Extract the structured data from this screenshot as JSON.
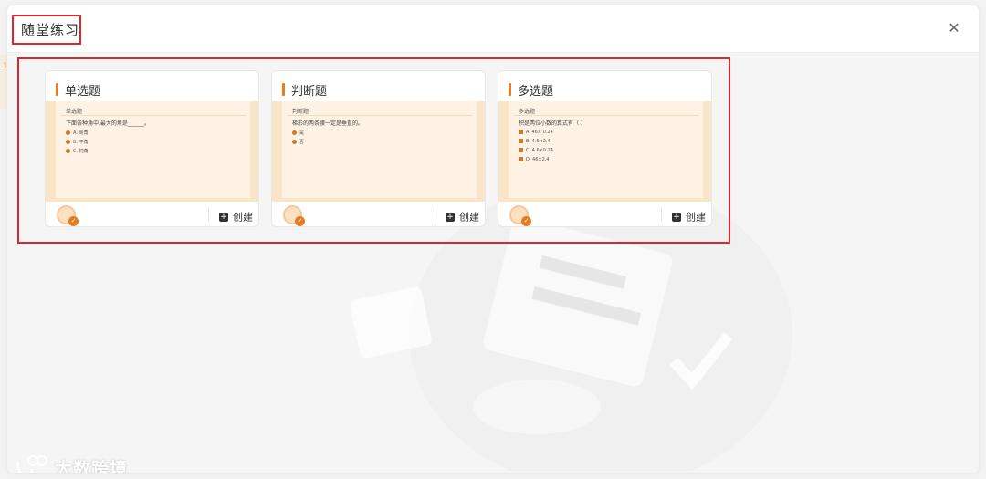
{
  "dialog": {
    "title": "随堂练习",
    "close_icon": "close-icon"
  },
  "background_digit": "1",
  "cards": [
    {
      "title": "单选题",
      "preview": {
        "type": "单选题",
        "question": "下面各种角中,最大的角是______。",
        "option_marker": "dot",
        "options": [
          "A. 周角",
          "B. 平角",
          "C. 钝角"
        ]
      },
      "create_label": "创建"
    },
    {
      "title": "判断题",
      "preview": {
        "type": "判断题",
        "question": "梯形的两条腰一定是垂直的。",
        "option_marker": "dot",
        "options": [
          "是",
          "否"
        ]
      },
      "create_label": "创建"
    },
    {
      "title": "多选题",
      "preview": {
        "type": "多选题",
        "question": "积是两位小数的算式有（ ）",
        "option_marker": "square",
        "options": [
          "A. 46× 0.24",
          "B. 4.6×2.4",
          "C. 4.6×0.24",
          "D. 46×2.4"
        ]
      },
      "create_label": "创建"
    }
  ],
  "watermark": {
    "brand_text": "大数跨境"
  },
  "colors": {
    "accent": "#e87a21",
    "highlight_border": "#e0262b",
    "preview_bg": "#fbe5c8",
    "preview_inner_bg": "#fdf2e3"
  }
}
